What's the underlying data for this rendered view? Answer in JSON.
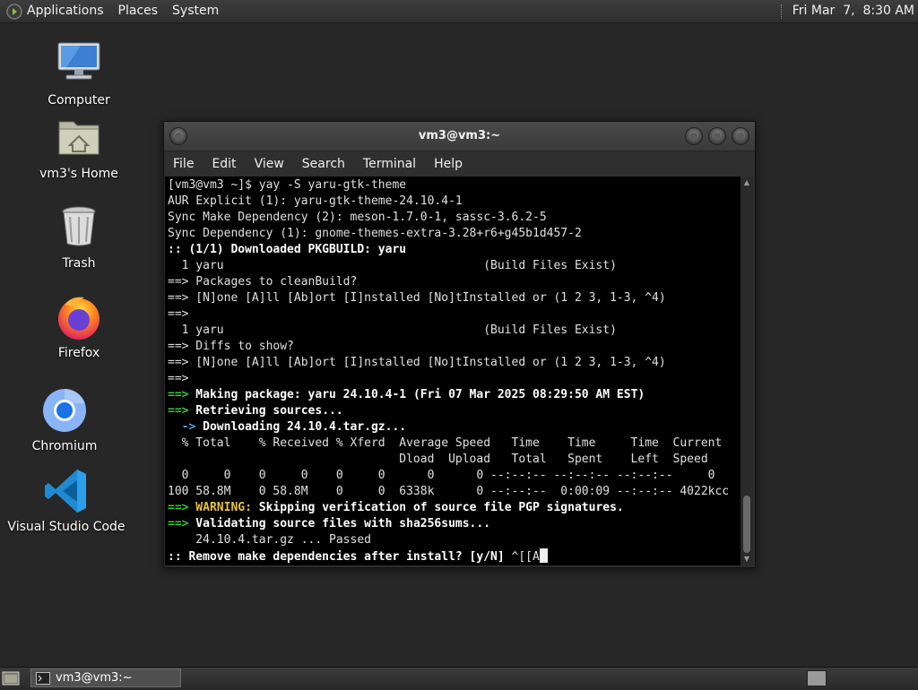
{
  "top_panel": {
    "menus": [
      "Applications",
      "Places",
      "System"
    ],
    "clock": "Fri Mar  7,  8:30 AM"
  },
  "desktop_icons": [
    {
      "label": "Computer",
      "icon": "computer-icon"
    },
    {
      "label": "vm3's Home",
      "icon": "home-folder-icon"
    },
    {
      "label": "Trash",
      "icon": "trash-icon"
    },
    {
      "label": "Firefox",
      "icon": "firefox-icon"
    },
    {
      "label": "Chromium",
      "icon": "chromium-icon"
    },
    {
      "label": "Visual Studio Code",
      "icon": "vscode-icon"
    }
  ],
  "terminal": {
    "title": "vm3@vm3:~",
    "menus": [
      "File",
      "Edit",
      "View",
      "Search",
      "Terminal",
      "Help"
    ],
    "lines": [
      {
        "t": "plain",
        "text": "[vm3@vm3 ~]$ yay -S yaru-gtk-theme"
      },
      {
        "t": "plain",
        "text": "AUR Explicit (1): yaru-gtk-theme-24.10.4-1"
      },
      {
        "t": "plain",
        "text": "Sync Make Dependency (2): meson-1.7.0-1, sassc-3.6.2-5"
      },
      {
        "t": "plain",
        "text": "Sync Dependency (1): gnome-themes-extra-3.28+r6+g45b1d457-2"
      },
      {
        "t": "bold",
        "text": ":: (1/1) Downloaded PKGBUILD: yaru"
      },
      {
        "t": "plain",
        "text": "  1 yaru                                     (Build Files Exist)"
      },
      {
        "t": "plain",
        "text": "==> Packages to cleanBuild?"
      },
      {
        "t": "plain",
        "text": "==> [N]one [A]ll [Ab]ort [I]nstalled [No]tInstalled or (1 2 3, 1-3, ^4)"
      },
      {
        "t": "plain",
        "text": "==>"
      },
      {
        "t": "plain",
        "text": "  1 yaru                                     (Build Files Exist)"
      },
      {
        "t": "plain",
        "text": "==> Diffs to show?"
      },
      {
        "t": "plain",
        "text": "==> [N]one [A]ll [Ab]ort [I]nstalled [No]tInstalled or (1 2 3, 1-3, ^4)"
      },
      {
        "t": "plain",
        "text": "==>"
      },
      {
        "t": "arrow",
        "prefix": "==>",
        "text": " Making package: yaru 24.10.4-1 (Fri 07 Mar 2025 08:29:50 AM EST)"
      },
      {
        "t": "arrow",
        "prefix": "==>",
        "text": " Retrieving sources..."
      },
      {
        "t": "blue",
        "prefix": "  ->",
        "text": " Downloading 24.10.4.tar.gz..."
      },
      {
        "t": "plain",
        "text": "  % Total    % Received % Xferd  Average Speed   Time    Time     Time  Current"
      },
      {
        "t": "plain",
        "text": "                                 Dload  Upload   Total   Spent    Left  Speed"
      },
      {
        "t": "plain",
        "text": "  0     0    0     0    0     0      0      0 --:--:-- --:--:-- --:--:--     0"
      },
      {
        "t": "plain",
        "text": "100 58.8M    0 58.8M    0     0  6338k      0 --:--:--  0:00:09 --:--:-- 4022kcc"
      },
      {
        "t": "warn",
        "prefix": "==>",
        "warn": " WARNING:",
        "text": " Skipping verification of source file PGP signatures."
      },
      {
        "t": "arrow",
        "prefix": "==>",
        "text": " Validating source files with sha256sums..."
      },
      {
        "t": "plain",
        "text": "    24.10.4.tar.gz ... Passed"
      },
      {
        "t": "prompt",
        "text": ":: Remove make dependencies after install? [y/N] ",
        "input": "^[[A"
      }
    ]
  },
  "taskbar": {
    "task_label": "vm3@vm3:~"
  }
}
